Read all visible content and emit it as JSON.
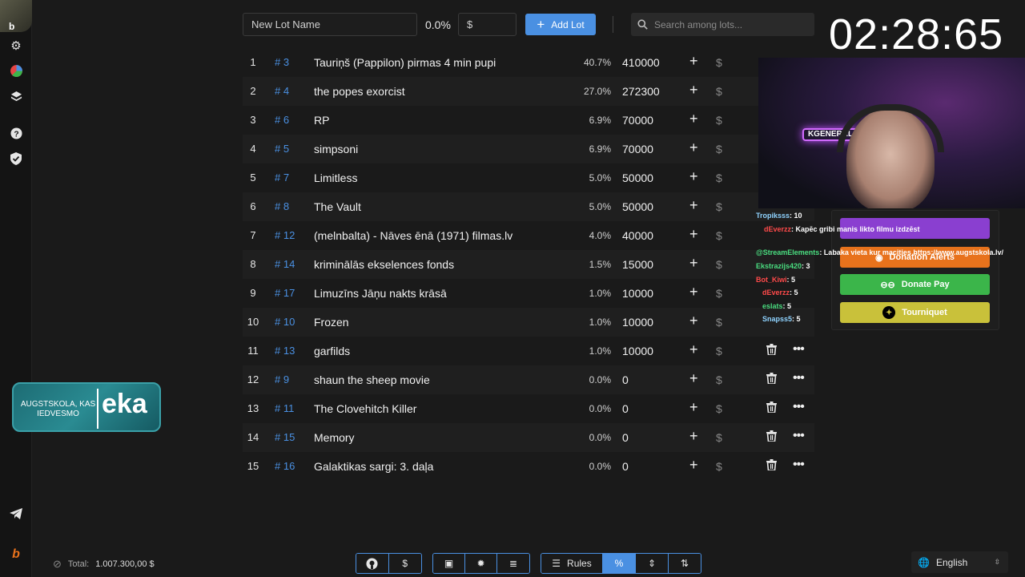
{
  "header": {
    "new_lot_placeholder": "New Lot Name",
    "percent_label": "0.0%",
    "amount_placeholder": "$",
    "add_lot_label": "Add Lot",
    "search_placeholder": "Search among lots..."
  },
  "timer": "02:28:65",
  "lots": [
    {
      "idx": "1",
      "id": "# 3",
      "name": "Tauriņš (Pappilon) pirmas 4 min pupi",
      "pct": "40.7%",
      "amount": "410000"
    },
    {
      "idx": "2",
      "id": "# 4",
      "name": "the popes exorcist",
      "pct": "27.0%",
      "amount": "272300"
    },
    {
      "idx": "3",
      "id": "# 6",
      "name": "RP",
      "pct": "6.9%",
      "amount": "70000"
    },
    {
      "idx": "4",
      "id": "# 5",
      "name": "simpsoni",
      "pct": "6.9%",
      "amount": "70000"
    },
    {
      "idx": "5",
      "id": "# 7",
      "name": "Limitless",
      "pct": "5.0%",
      "amount": "50000"
    },
    {
      "idx": "6",
      "id": "# 8",
      "name": "The Vault",
      "pct": "5.0%",
      "amount": "50000"
    },
    {
      "idx": "7",
      "id": "# 12",
      "name": "(melnbalta) - Nāves ēnā (1971) filmas.lv",
      "pct": "4.0%",
      "amount": "40000"
    },
    {
      "idx": "8",
      "id": "# 14",
      "name": "kriminālās ekselences fonds",
      "pct": "1.5%",
      "amount": "15000"
    },
    {
      "idx": "9",
      "id": "# 17",
      "name": "Limuzīns Jāņu nakts krāsā",
      "pct": "1.0%",
      "amount": "10000"
    },
    {
      "idx": "10",
      "id": "# 10",
      "name": "Frozen",
      "pct": "1.0%",
      "amount": "10000"
    },
    {
      "idx": "11",
      "id": "# 13",
      "name": "garfilds",
      "pct": "1.0%",
      "amount": "10000"
    },
    {
      "idx": "12",
      "id": "# 9",
      "name": "shaun the sheep movie",
      "pct": "0.0%",
      "amount": "0"
    },
    {
      "idx": "13",
      "id": "# 11",
      "name": "The Clovehitch Killer",
      "pct": "0.0%",
      "amount": "0"
    },
    {
      "idx": "14",
      "id": "# 15",
      "name": "Memory",
      "pct": "0.0%",
      "amount": "0"
    },
    {
      "idx": "15",
      "id": "# 16",
      "name": "Galaktikas sargi: 3. daļa",
      "pct": "0.0%",
      "amount": "0"
    }
  ],
  "overlay": {
    "cam_logo": "KGENERAL",
    "chat": [
      {
        "user": "Tropiksss",
        "text": ": 10",
        "color": "#8fd3ff"
      },
      {
        "user": "dEverzz",
        "text": ": Kapēc gribi manis likto filmu izdzēst",
        "color": "#ff4a4a"
      },
      {
        "user": "@StreamElements",
        "text": ": Labaka vieta kur macities https://www.augstskola.lv/",
        "color": "#4ade80"
      },
      {
        "user": "Ekstrazijs420",
        "text": ": 3",
        "color": "#4ade80"
      },
      {
        "user": "Bot_Kiwi",
        "text": ": 5",
        "color": "#ff4a4a"
      },
      {
        "user": "dEverzz",
        "text": ": 5",
        "color": "#ff4a4a"
      },
      {
        "user": "eslats",
        "text": ": 5",
        "color": "#4ade80"
      },
      {
        "user": "Snapss5",
        "text": ": 5",
        "color": "#8fd3ff"
      }
    ],
    "donation_alerts": "Donation Alerts",
    "donate_pay": "Donate Pay",
    "tourniquet": "Tourniquet",
    "banner_left": "AUGSTSKOLA, KAS IEDVESMO",
    "banner_right": "eka"
  },
  "footer": {
    "total_label": "Total:",
    "total_value": "1.007.300,00 $",
    "rules_label": "Rules",
    "language": "English"
  },
  "colors": {
    "accent": "#4a90e2",
    "donate_pay": "#3bb54a",
    "tourniquet": "#c9c13a",
    "donation_alerts": "#e8721c"
  }
}
